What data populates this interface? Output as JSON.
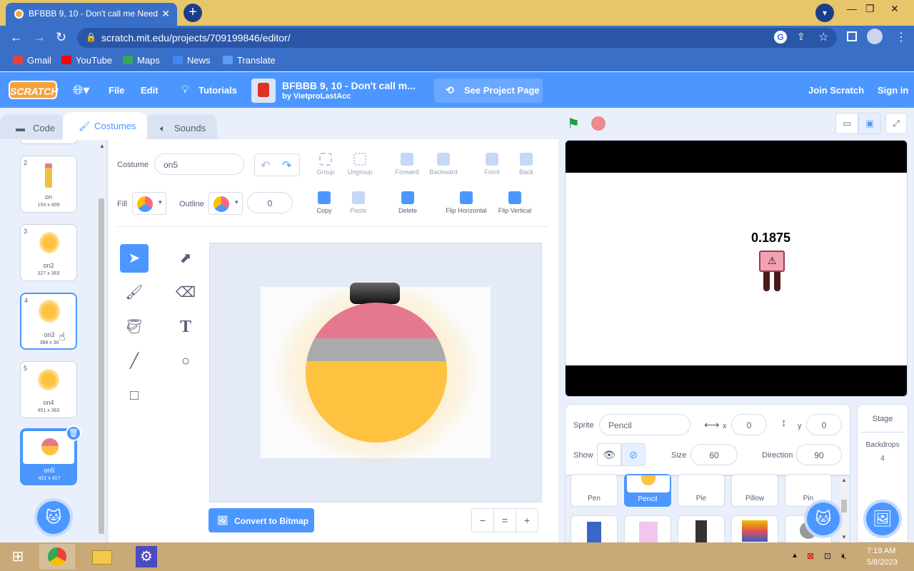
{
  "browser": {
    "tab_title": "BFBBB 9, 10 - Don't call me Need",
    "tab_close": "✕",
    "new_tab": "+",
    "url": "scratch.mit.edu/projects/709199846/editor/",
    "bookmarks": [
      "Gmail",
      "YouTube",
      "Maps",
      "News",
      "Translate"
    ]
  },
  "menu": {
    "logo": "SCRATCH",
    "file": "File",
    "edit": "Edit",
    "tutorials": "Tutorials",
    "project_title": "BFBBB 9, 10 - Don't call m...",
    "author": "by VietproLastAcc",
    "see_project": "See Project Page",
    "join": "Join Scratch",
    "signin": "Sign in"
  },
  "editor_tabs": [
    "Code",
    "Costumes",
    "Sounds"
  ],
  "costumes": [
    {
      "num": "2",
      "name": "on",
      "dims": "154 x 409"
    },
    {
      "num": "3",
      "name": "on2",
      "dims": "327 x 363"
    },
    {
      "num": "4",
      "name": "on3",
      "dims": "388 x 36"
    },
    {
      "num": "5",
      "name": "on4",
      "dims": "451 x 363"
    },
    {
      "num": "6",
      "name": "on5",
      "dims": "421 x 417"
    }
  ],
  "paint": {
    "costume_label": "Costume",
    "costume_name": "on5",
    "fill_label": "Fill",
    "outline_label": "Outline",
    "outline_width": "0",
    "group": "Group",
    "ungroup": "Ungroup",
    "forward": "Forward",
    "backward": "Backward",
    "front": "Front",
    "back": "Back",
    "copy": "Copy",
    "paste": "Paste",
    "delete": "Delete",
    "flip_h": "Flip Horizontal",
    "flip_v": "Flip Vertical",
    "convert": "Convert to Bitmap",
    "zoom_out": "−",
    "zoom_reset": "=",
    "zoom_in": "+"
  },
  "stage": {
    "value_text": "0.1875"
  },
  "sprite": {
    "sprite_label": "Sprite",
    "sprite_name": "Pencil",
    "x_label": "x",
    "x": "0",
    "y_label": "y",
    "y": "0",
    "show_label": "Show",
    "size_label": "Size",
    "size": "60",
    "direction_label": "Direction",
    "direction": "90",
    "list": [
      "Pen",
      "Pencil",
      "Pie",
      "Pillow",
      "Pin"
    ]
  },
  "stage_panel": {
    "title": "Stage",
    "backdrops_label": "Backdrops",
    "backdrops": "4"
  },
  "taskbar": {
    "time": "7:19 AM",
    "date": "5/8/2023"
  },
  "colors": {
    "scratch_blue": "#4c97ff",
    "chrome_blue": "#3a6fc8",
    "tab_yellow": "#e7c56a",
    "costume_pink": "#e5788f",
    "costume_gray": "#aaaaaa",
    "costume_yellow": "#ffc240"
  }
}
